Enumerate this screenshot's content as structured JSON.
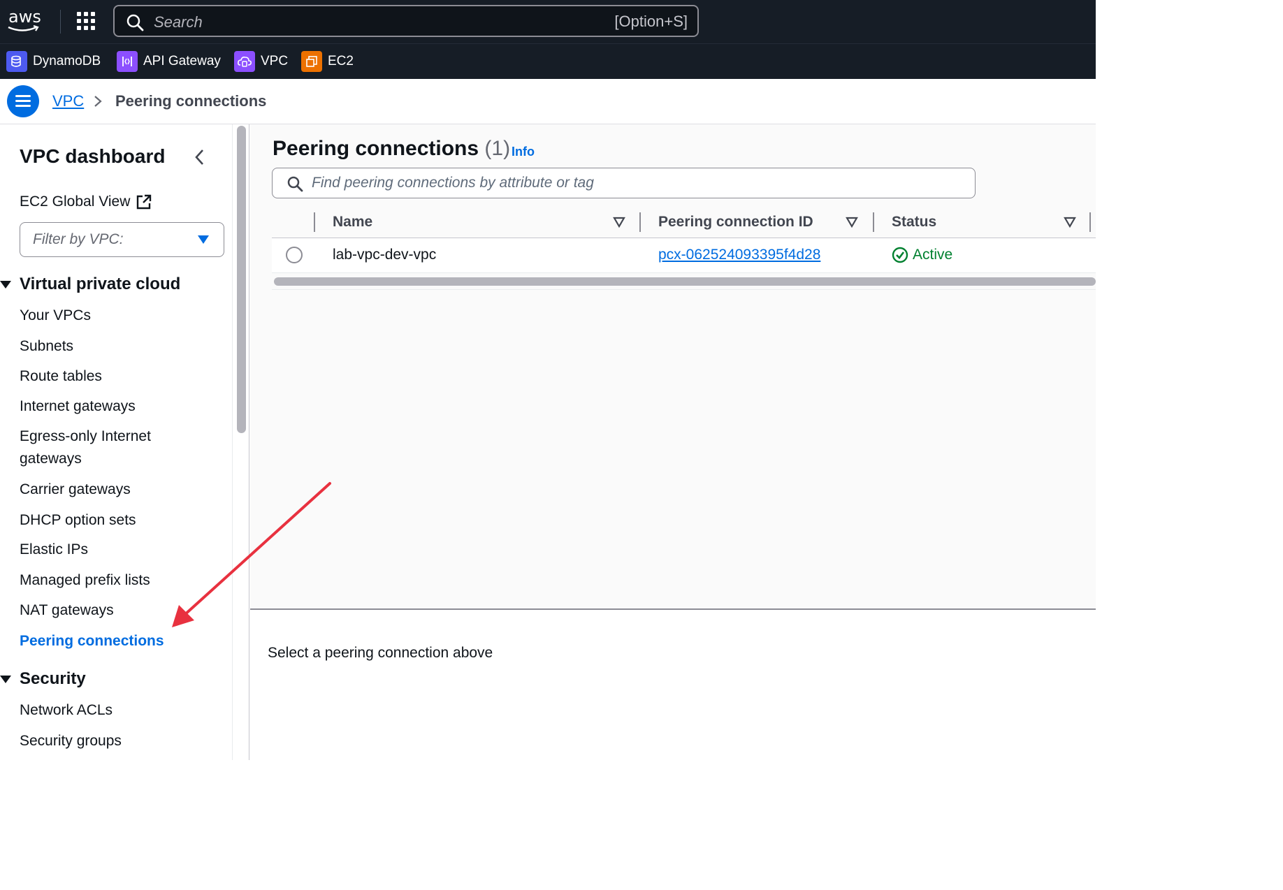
{
  "topbar": {
    "logo_text": "aws",
    "search_placeholder": "Search",
    "search_shortcut": "[Option+S]"
  },
  "favorites": [
    {
      "label": "DynamoDB",
      "icon": "dynamodb-icon",
      "color": "#4d5af0"
    },
    {
      "label": "API Gateway",
      "icon": "api-gateway-icon",
      "color": "#8c4fff"
    },
    {
      "label": "VPC",
      "icon": "vpc-icon",
      "color": "#8c4fff"
    },
    {
      "label": "EC2",
      "icon": "ec2-icon",
      "color": "#ed7100"
    }
  ],
  "breadcrumb": {
    "root": "VPC",
    "current": "Peering connections"
  },
  "sidebar": {
    "title": "VPC dashboard",
    "ec2_global_view": "EC2 Global View",
    "filter_placeholder": "Filter by VPC:",
    "section_vpc": "Virtual private cloud",
    "vpc_items": [
      "Your VPCs",
      "Subnets",
      "Route tables",
      "Internet gateways",
      "Egress-only Internet gateways",
      "Carrier gateways",
      "DHCP option sets",
      "Elastic IPs",
      "Managed prefix lists",
      "NAT gateways",
      "Peering connections"
    ],
    "active_item": "Peering connections",
    "section_security": "Security",
    "security_items": [
      "Network ACLs",
      "Security groups"
    ]
  },
  "main": {
    "title": "Peering connections",
    "count": "(1)",
    "info": "Info",
    "search_placeholder": "Find peering connections by attribute or tag",
    "columns": [
      "Name",
      "Peering connection ID",
      "Status"
    ],
    "rows": [
      {
        "name": "lab-vpc-dev-vpc",
        "id": "pcx-062524093395f4d28",
        "status": "Active"
      }
    ],
    "detail_empty": "Select a peering connection above"
  },
  "colors": {
    "accent": "#006ce0",
    "status_active": "#00802f",
    "topbar_bg": "#161d26",
    "annotation_arrow": "#e8313f"
  }
}
